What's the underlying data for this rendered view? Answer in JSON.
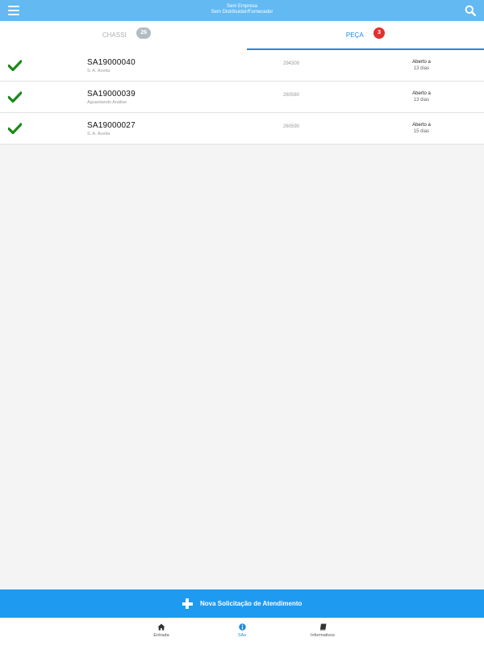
{
  "header": {
    "company": "Sem Empresa",
    "distributor": "Sem Distribuidor/Fornecedor"
  },
  "tabs": [
    {
      "label": "CHASSI",
      "count": "26",
      "active": false
    },
    {
      "label": "PEÇA",
      "count": "3",
      "active": true
    }
  ],
  "rows": [
    {
      "id": "SA19000040",
      "subtitle": "S. A. Aceita",
      "code": "294309",
      "status": "Aberto a",
      "days": "13 dias",
      "icon": "check-icon"
    },
    {
      "id": "SA19000039",
      "subtitle": "Aguardando Análise",
      "code": "260580",
      "status": "Aberto a",
      "days": "13 dias",
      "icon": "check-icon"
    },
    {
      "id": "SA19000027",
      "subtitle": "S. A. Aceita",
      "code": "260590",
      "status": "Aberto a",
      "days": "15 dias",
      "icon": "check-icon"
    }
  ],
  "new_button": {
    "label": "Nova Solicitação de Atendimento",
    "icon": "plus-icon"
  },
  "bottom_nav": [
    {
      "label": "Entrada",
      "icon": "home-icon",
      "active": false
    },
    {
      "label": "SAs",
      "icon": "info-icon",
      "active": true
    },
    {
      "label": "Informativos",
      "icon": "book-icon",
      "active": false
    }
  ],
  "colors": {
    "header": "#63b9f2",
    "accent": "#1e88e5",
    "button": "#1e9af0",
    "check": "#1a8a1a",
    "badge_inactive": "#b3bcc4",
    "badge_active": "#e03131"
  }
}
